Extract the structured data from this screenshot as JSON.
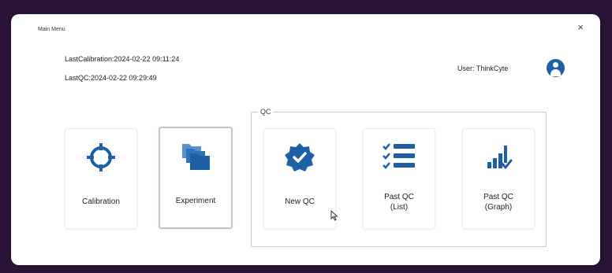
{
  "window": {
    "title": "Main Menu",
    "close_glyph": "×"
  },
  "status": {
    "last_calibration": "LastCalibration:2024-02-22 09:11:24",
    "last_qc": "LastQC:2024-02-22 09:29:49",
    "user": "User: ThinkCyte"
  },
  "qc_group": {
    "label": "QC"
  },
  "tiles": {
    "calibration": {
      "label": "Calibration",
      "icon": "crosshair-icon"
    },
    "experiment": {
      "label": "Experiment",
      "icon": "folders-icon"
    },
    "new_qc": {
      "label": "New QC",
      "icon": "verified-badge-icon"
    },
    "past_qc_list": {
      "label": "Past QC\n(List)",
      "icon": "checklist-icon"
    },
    "past_qc_graph": {
      "label": "Past QC\n(Graph)",
      "icon": "bar-chart-check-icon"
    }
  },
  "colors": {
    "accent": "#1f5fa5",
    "background": "#2a1538"
  }
}
